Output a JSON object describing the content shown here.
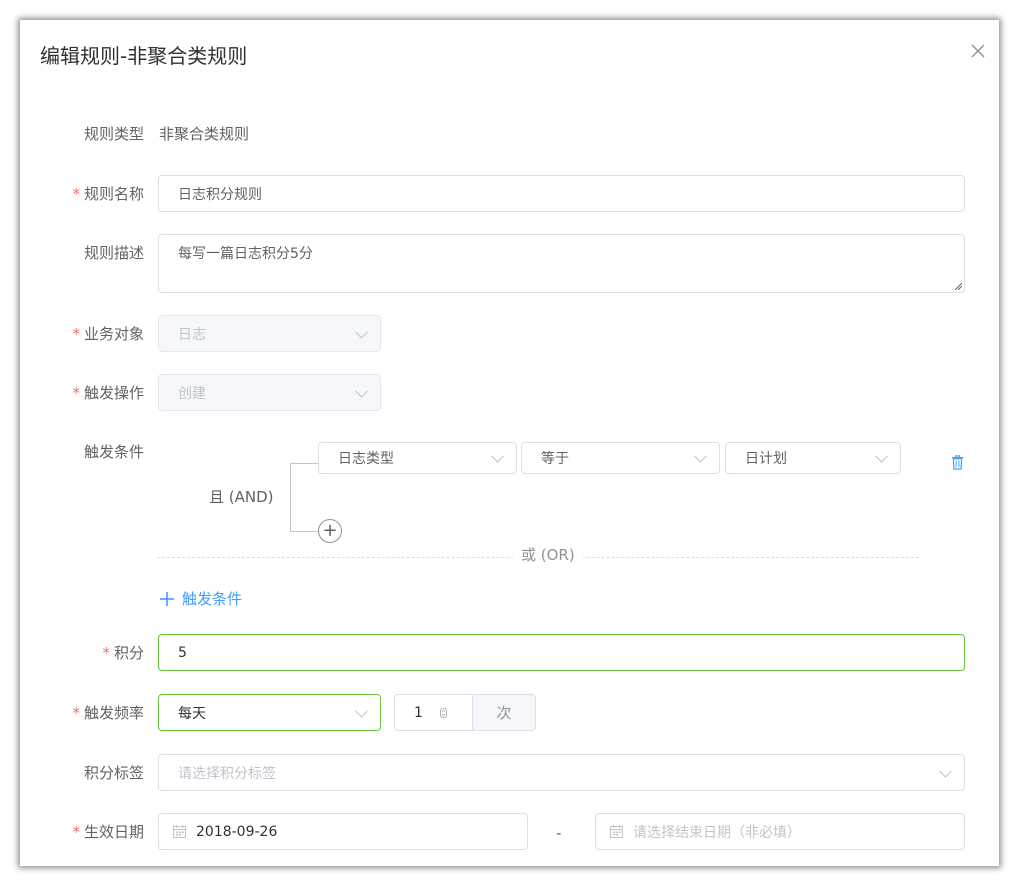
{
  "dialog": {
    "title": "编辑规则-非聚合类规则"
  },
  "form": {
    "rule_type": {
      "label": "规则类型",
      "value": "非聚合类规则"
    },
    "rule_name": {
      "label": "规则名称",
      "value": "日志积分规则",
      "required": true
    },
    "rule_desc": {
      "label": "规则描述",
      "value": "每写一篇日志积分5分"
    },
    "business_object": {
      "label": "业务对象",
      "value": "日志",
      "required": true,
      "disabled": true
    },
    "trigger_action": {
      "label": "触发操作",
      "value": "创建",
      "required": true,
      "disabled": true
    },
    "trigger_conditions": {
      "label": "触发条件",
      "group_logic": "且 (AND)",
      "condition": {
        "field": "日志类型",
        "operator": "等于",
        "value": "日计划"
      },
      "separator": "或 (OR)",
      "add_label": "触发条件"
    },
    "points": {
      "label": "积分",
      "value": "5",
      "required": true
    },
    "frequency": {
      "label": "触发频率",
      "value": "每天",
      "required": true,
      "count": "1",
      "unit": "次"
    },
    "points_tag": {
      "label": "积分标签",
      "placeholder": "请选择积分标签"
    },
    "effective_date": {
      "label": "生效日期",
      "required": true,
      "start": "2018-09-26",
      "separator": "-",
      "end_placeholder": "请选择结束日期（非必填）"
    }
  },
  "colors": {
    "required": "#f56c6c",
    "link": "#409eff",
    "valid_border": "#67c23a"
  },
  "icons": [
    "close-icon",
    "chevron-down-icon",
    "delete-icon",
    "plus-icon",
    "calendar-icon"
  ]
}
